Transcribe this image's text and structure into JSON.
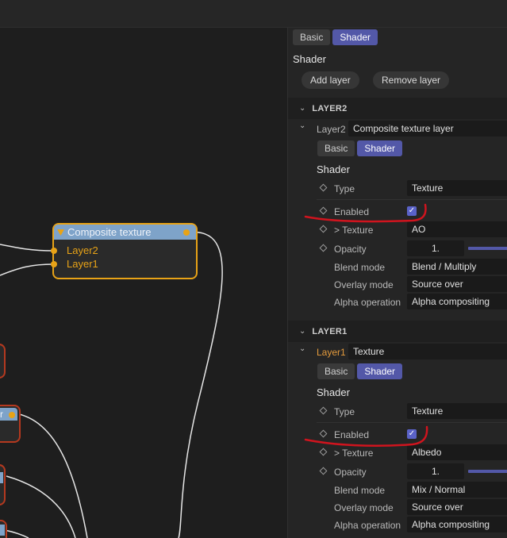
{
  "node_graph": {
    "composite_node": {
      "title": "Composite texture",
      "inputs": [
        "Layer2",
        "Layer1"
      ]
    },
    "stub_node_label": "r"
  },
  "inspector": {
    "top_tabs": [
      "Basic",
      "Shader"
    ],
    "active_tab": "Shader",
    "title": "Shader",
    "add_layer": "Add layer",
    "remove_layer": "Remove layer",
    "layers": [
      {
        "section": "LAYER2",
        "layer_label": "Layer2",
        "layer_name": "Composite texture layer",
        "tabs": [
          "Basic",
          "Shader"
        ],
        "shader_title": "Shader",
        "type_label": "Type",
        "type_value": "Texture",
        "enabled_label": "Enabled",
        "enabled": true,
        "texture_label": "> Texture",
        "texture_value": "AO",
        "opacity_label": "Opacity",
        "opacity_value": "1.",
        "blend_label": "Blend mode",
        "blend_value": "Blend / Multiply",
        "overlay_label": "Overlay mode",
        "overlay_value": "Source over",
        "alpha_label": "Alpha operation",
        "alpha_value": "Alpha compositing"
      },
      {
        "section": "LAYER1",
        "layer_label": "Layer1",
        "layer_name": "Texture",
        "tabs": [
          "Basic",
          "Shader"
        ],
        "shader_title": "Shader",
        "type_label": "Type",
        "type_value": "Texture",
        "enabled_label": "Enabled",
        "enabled": true,
        "texture_label": "> Texture",
        "texture_value": "Albedo",
        "opacity_label": "Opacity",
        "opacity_value": "1.",
        "blend_label": "Blend mode",
        "blend_value": "Mix / Normal",
        "overlay_label": "Overlay mode",
        "overlay_value": "Source over",
        "alpha_label": "Alpha operation",
        "alpha_value": "Alpha compositing"
      }
    ]
  },
  "icons": {
    "collapse": "chevron-down-icon",
    "property_key": "diamond-icon",
    "node_collapse": "triangle-down-icon",
    "checkbox": "checkmark-icon"
  },
  "colors": {
    "accent": "#5358a8",
    "node_border": "#e8a317",
    "node_header": "#7ea3c9",
    "error_node": "#b5391f",
    "annotation": "#d0141e"
  }
}
